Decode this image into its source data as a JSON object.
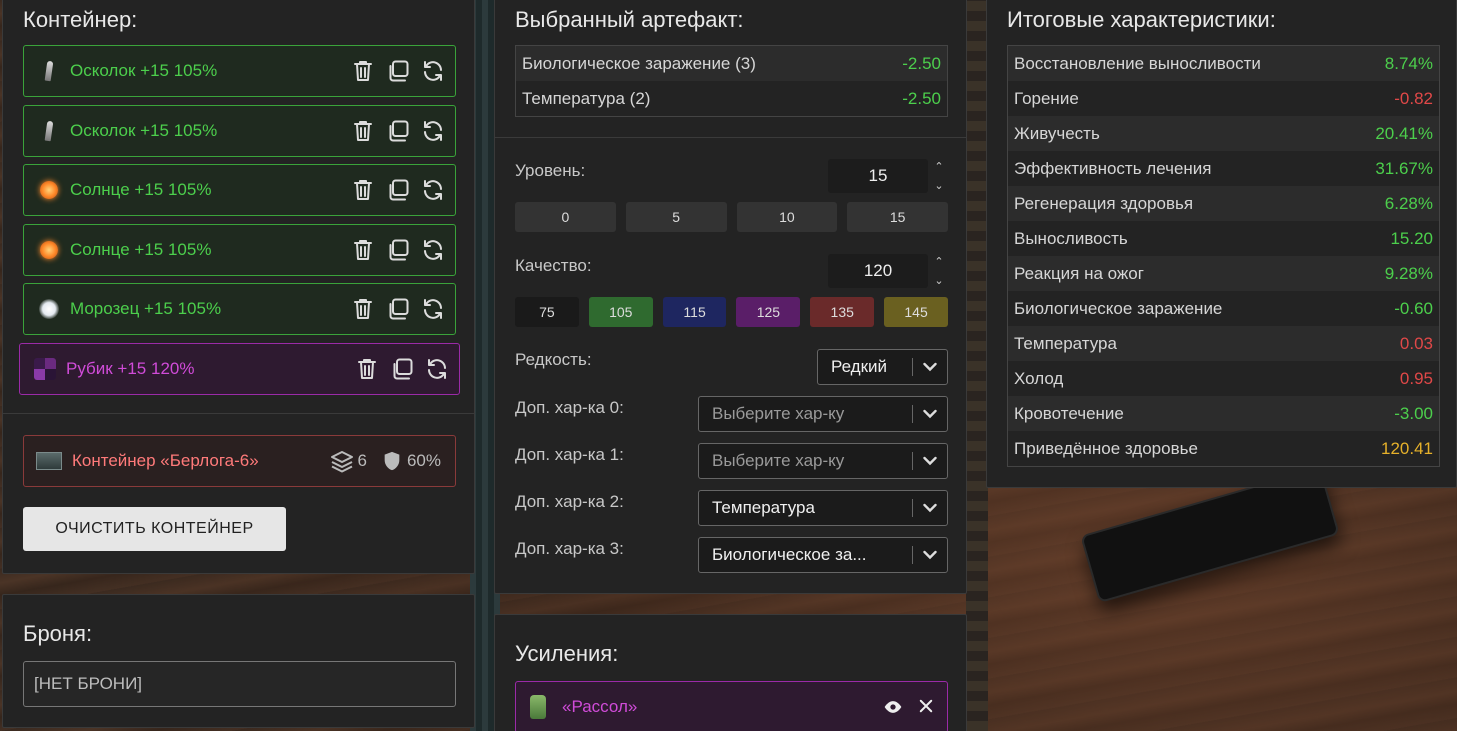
{
  "container": {
    "title": "Контейнер:",
    "items": [
      {
        "icon": "shard-icon",
        "name": "Осколок +15 105%",
        "rarity": "common"
      },
      {
        "icon": "shard-icon",
        "name": "Осколок +15 105%",
        "rarity": "common"
      },
      {
        "icon": "sun-icon",
        "name": "Солнце +15 105%",
        "rarity": "common"
      },
      {
        "icon": "sun-icon",
        "name": "Солнце +15 105%",
        "rarity": "common"
      },
      {
        "icon": "frost-icon",
        "name": "Морозец +15 105%",
        "rarity": "common"
      },
      {
        "icon": "cube-icon",
        "name": "Рубик +15 120%",
        "rarity": "rare"
      }
    ],
    "card": {
      "name": "Контейнер «Берлога-6»",
      "slots": "6",
      "protection": "60%"
    },
    "clear_label": "ОЧИСТИТЬ КОНТЕЙНЕР"
  },
  "armor": {
    "title": "Броня:",
    "value": "[НЕТ БРОНИ]"
  },
  "selected": {
    "title": "Выбранный артефакт:",
    "stats": [
      {
        "name": "Биологическое заражение (3)",
        "value": "-2.50"
      },
      {
        "name": "Температура (2)",
        "value": "-2.50"
      }
    ],
    "level_label": "Уровень:",
    "level_value": "15",
    "level_presets": [
      "0",
      "5",
      "10",
      "15"
    ],
    "quality_label": "Качество:",
    "quality_value": "120",
    "quality_presets": [
      {
        "label": "75",
        "color": "#1a1a1a"
      },
      {
        "label": "105",
        "color": "#2f6a2f"
      },
      {
        "label": "115",
        "color": "#1e2660"
      },
      {
        "label": "125",
        "color": "#5a1e68"
      },
      {
        "label": "135",
        "color": "#6a2a2a"
      },
      {
        "label": "145",
        "color": "#6a6020"
      }
    ],
    "rarity_label": "Редкость:",
    "rarity_value": "Редкий",
    "extras": [
      {
        "label": "Доп. хар-ка 0:",
        "value": "Выберите хар-ку",
        "placeholder": true
      },
      {
        "label": "Доп. хар-ка 1:",
        "value": "Выберите хар-ку",
        "placeholder": true
      },
      {
        "label": "Доп. хар-ка 2:",
        "value": "Температура",
        "placeholder": false
      },
      {
        "label": "Доп. хар-ка 3:",
        "value": "Биологическое за...",
        "placeholder": false
      }
    ]
  },
  "boosts": {
    "title": "Усиления:",
    "items": [
      {
        "name": "«Рассол»"
      }
    ]
  },
  "totals": {
    "title": "Итоговые характеристики:",
    "rows": [
      {
        "name": "Восстановление выносливости",
        "value": "8.74%",
        "tone": "green"
      },
      {
        "name": "Горение",
        "value": "-0.82",
        "tone": "red"
      },
      {
        "name": "Живучесть",
        "value": "20.41%",
        "tone": "green"
      },
      {
        "name": "Эффективность лечения",
        "value": "31.67%",
        "tone": "green"
      },
      {
        "name": "Регенерация здоровья",
        "value": "6.28%",
        "tone": "green"
      },
      {
        "name": "Выносливость",
        "value": "15.20",
        "tone": "green"
      },
      {
        "name": "Реакция на ожог",
        "value": "9.28%",
        "tone": "green"
      },
      {
        "name": "Биологическое заражение",
        "value": "-0.60",
        "tone": "green"
      },
      {
        "name": "Температура",
        "value": "0.03",
        "tone": "red"
      },
      {
        "name": "Холод",
        "value": "0.95",
        "tone": "red"
      },
      {
        "name": "Кровотечение",
        "value": "-3.00",
        "tone": "green"
      },
      {
        "name": "Приведённое здоровье",
        "value": "120.41",
        "tone": "gold"
      }
    ]
  }
}
